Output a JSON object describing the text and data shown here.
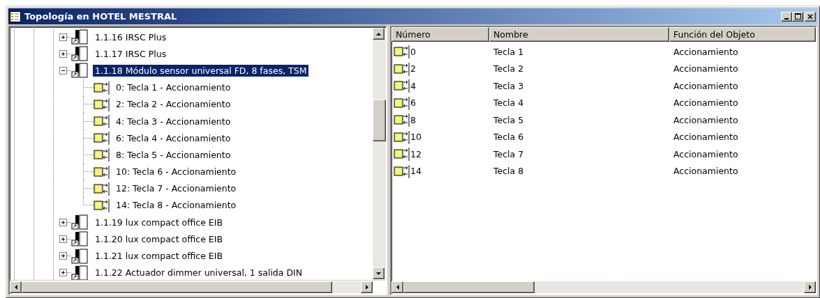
{
  "window": {
    "title": "Topología en HOTEL MESTRAL"
  },
  "tree": {
    "items": [
      {
        "kind": "device",
        "label": "1.1.16 IRSC Plus",
        "expanded": false,
        "selected": false
      },
      {
        "kind": "device",
        "label": "1.1.17 IRSC Plus",
        "expanded": false,
        "selected": false
      },
      {
        "kind": "device",
        "label": "1.1.18 Módulo sensor universal FD, 8 fases, TSM",
        "expanded": true,
        "selected": true,
        "children": [
          {
            "kind": "object",
            "label": "0: Tecla 1 - Accionamiento",
            "selected": false
          },
          {
            "kind": "object",
            "label": "2: Tecla 2 - Accionamiento",
            "selected": false
          },
          {
            "kind": "object",
            "label": "4: Tecla 3 - Accionamiento",
            "selected": false
          },
          {
            "kind": "object",
            "label": "6: Tecla 4 - Accionamiento",
            "selected": false
          },
          {
            "kind": "object",
            "label": "8: Tecla 5 - Accionamiento",
            "selected": false
          },
          {
            "kind": "object",
            "label": "10: Tecla 6 - Accionamiento",
            "selected": false
          },
          {
            "kind": "object",
            "label": "12: Tecla 7 - Accionamiento",
            "selected": false
          },
          {
            "kind": "object",
            "label": "14: Tecla 8 - Accionamiento",
            "selected": false
          }
        ]
      },
      {
        "kind": "device",
        "label": "1.1.19 lux compact office EIB",
        "expanded": false,
        "selected": false
      },
      {
        "kind": "device",
        "label": "1.1.20 lux compact office EIB",
        "expanded": false,
        "selected": false
      },
      {
        "kind": "device",
        "label": "1.1.21 lux compact office EIB",
        "expanded": false,
        "selected": false
      },
      {
        "kind": "device",
        "label": "1.1.22 Actuador dimmer universal, 1 salida DIN",
        "expanded": false,
        "selected": false
      }
    ]
  },
  "table": {
    "columns": [
      "Número",
      "Nombre",
      "Función del Objeto"
    ],
    "rows": [
      {
        "cells": [
          "0",
          "Tecla 1",
          "Accionamiento"
        ]
      },
      {
        "cells": [
          "2",
          "Tecla 2",
          "Accionamiento"
        ]
      },
      {
        "cells": [
          "4",
          "Tecla 3",
          "Accionamiento"
        ]
      },
      {
        "cells": [
          "6",
          "Tecla 4",
          "Accionamiento"
        ]
      },
      {
        "cells": [
          "8",
          "Tecla 5",
          "Accionamiento"
        ]
      },
      {
        "cells": [
          "10",
          "Tecla 6",
          "Accionamiento"
        ]
      },
      {
        "cells": [
          "12",
          "Tecla 7",
          "Accionamiento"
        ]
      },
      {
        "cells": [
          "14",
          "Tecla 8",
          "Accionamiento"
        ]
      }
    ]
  }
}
